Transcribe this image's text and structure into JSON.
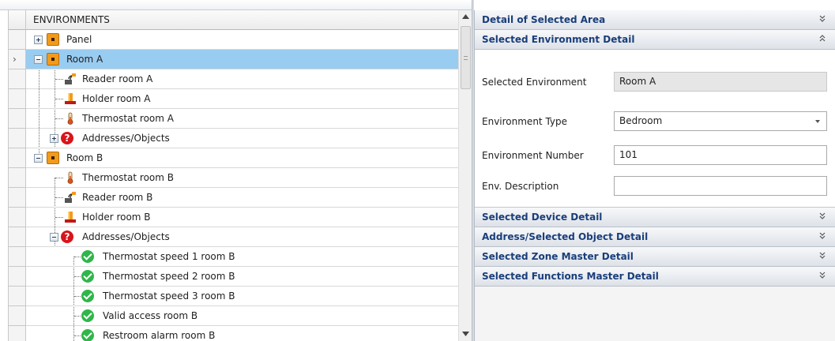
{
  "tree": {
    "column_header": "ENVIRONMENTS",
    "nodes": [
      {
        "label": "Panel",
        "level": 0,
        "icon": "environment-icon",
        "expander": "plus"
      },
      {
        "label": "Room A",
        "level": 0,
        "icon": "environment-icon",
        "expander": "minus",
        "selected": true
      },
      {
        "label": "Reader room A",
        "level": 1,
        "icon": "reader-icon"
      },
      {
        "label": "Holder room A",
        "level": 1,
        "icon": "holder-icon"
      },
      {
        "label": "Thermostat room A",
        "level": 1,
        "icon": "thermostat-icon"
      },
      {
        "label": "Addresses/Objects",
        "level": 1,
        "icon": "question-icon",
        "expander": "plus"
      },
      {
        "label": "Room B",
        "level": 0,
        "icon": "environment-icon",
        "expander": "minus"
      },
      {
        "label": "Thermostat room B",
        "level": 1,
        "icon": "thermostat-icon"
      },
      {
        "label": "Reader room B",
        "level": 1,
        "icon": "reader-icon"
      },
      {
        "label": "Holder room B",
        "level": 1,
        "icon": "holder-icon"
      },
      {
        "label": "Addresses/Objects",
        "level": 1,
        "icon": "question-icon",
        "expander": "minus"
      },
      {
        "label": "Thermostat speed 1 room B",
        "level": 2,
        "icon": "check-icon"
      },
      {
        "label": "Thermostat speed 2 room B",
        "level": 2,
        "icon": "check-icon"
      },
      {
        "label": "Thermostat speed 3 room B",
        "level": 2,
        "icon": "check-icon"
      },
      {
        "label": "Valid access room B",
        "level": 2,
        "icon": "check-icon"
      },
      {
        "label": "Restroom alarm room B",
        "level": 2,
        "icon": "check-icon"
      }
    ]
  },
  "details": {
    "groups": {
      "area": "Detail of Selected Area",
      "environment": "Selected Environment Detail",
      "device": "Selected Device Detail",
      "address": "Address/Selected Object Detail",
      "zone": "Selected Zone Master Detail",
      "functions": "Selected Functions Master Detail"
    },
    "environment": {
      "selected_label": "Selected Environment",
      "selected_value": "Room A",
      "type_label": "Environment Type",
      "type_value": "Bedroom",
      "number_label": "Environment Number",
      "number_value": "101",
      "description_label": "Env. Description",
      "description_value": ""
    }
  },
  "colors": {
    "selection": "#99ccf1",
    "group_title": "#1a3e7a",
    "environment_icon": "#f39a1b",
    "question_icon": "#d9141a",
    "check_icon": "#2fb64a"
  }
}
